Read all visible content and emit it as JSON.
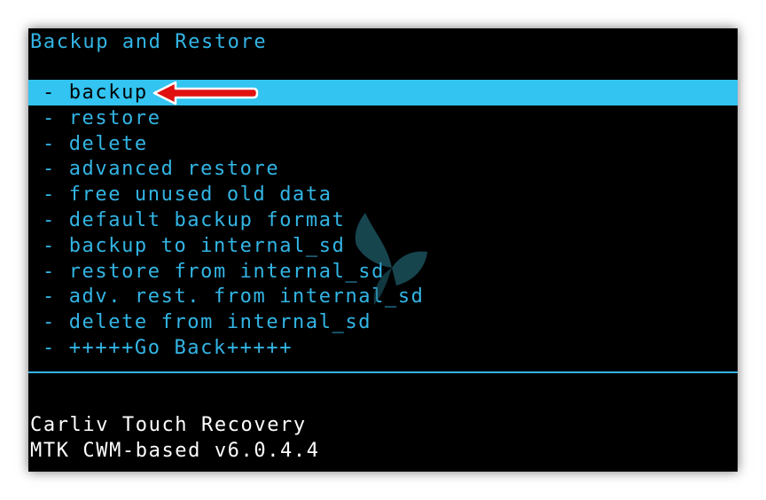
{
  "colors": {
    "text": "#33b5e5",
    "highlight_bg": "#33c4f1",
    "highlight_text": "#000000",
    "screen_bg": "#000000",
    "footer_text": "#ffffff",
    "arrow": "#e01010"
  },
  "header": {
    "title": "Backup and Restore"
  },
  "menu": {
    "selected_index": 0,
    "items": [
      {
        "label": "- backup"
      },
      {
        "label": "- restore"
      },
      {
        "label": "- delete"
      },
      {
        "label": "- advanced restore"
      },
      {
        "label": "- free unused old data"
      },
      {
        "label": "- default backup format"
      },
      {
        "label": "- backup to internal_sd"
      },
      {
        "label": "- restore from internal_sd"
      },
      {
        "label": "- adv. rest. from internal_sd"
      },
      {
        "label": "- delete from internal_sd"
      },
      {
        "label": "- +++++Go Back+++++"
      }
    ]
  },
  "footer": {
    "line1": "Carliv Touch Recovery",
    "line2": "MTK CWM-based v6.0.4.4"
  },
  "annotations": {
    "arrow_icon": "left-arrow-icon",
    "watermark_icon": "butterfly-watermark-icon"
  }
}
